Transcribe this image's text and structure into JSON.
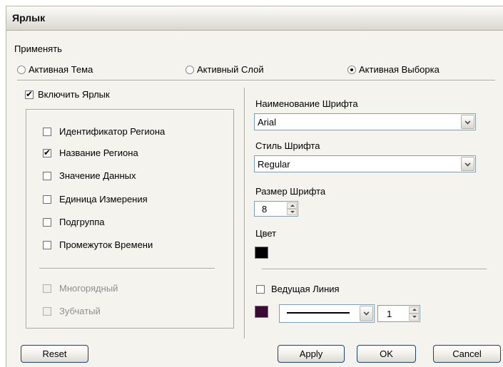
{
  "window": {
    "title": "Ярлык"
  },
  "apply_to": {
    "label": "Применять",
    "options": [
      {
        "label": "Активная Тема",
        "checked": false
      },
      {
        "label": "Активный Слой",
        "checked": false
      },
      {
        "label": "Активная Выборка",
        "checked": true
      }
    ]
  },
  "left": {
    "enable_label": {
      "label": "Включить Ярлык",
      "checked": true
    },
    "fields": [
      {
        "label": "Идентификатор Региона",
        "checked": false
      },
      {
        "label": "Название Региона",
        "checked": true
      },
      {
        "label": "Значение Данных",
        "checked": false
      },
      {
        "label": "Единица Измерения",
        "checked": false
      },
      {
        "label": "Подгруппа",
        "checked": false
      },
      {
        "label": "Промежуток Времени",
        "checked": false
      }
    ],
    "multiline": {
      "label": "Многорядный",
      "checked": false,
      "disabled": true
    },
    "jagged": {
      "label": "Зубчатый",
      "checked": false,
      "disabled": true
    }
  },
  "right": {
    "font_name_label": "Наименование Шрифта",
    "font_name_value": "Arial",
    "font_style_label": "Стиль Шрифта",
    "font_style_value": "Regular",
    "font_size_label": "Размер Шрифта",
    "font_size_value": "8",
    "color_label": "Цвет",
    "color_value": "#000000",
    "leader_line": {
      "label": "Ведущая Линия",
      "checked": false
    },
    "leader_color": "#3b0a35",
    "line_width_value": "1"
  },
  "buttons": {
    "reset": "Reset",
    "apply": "Apply",
    "ok": "OK",
    "cancel": "Cancel"
  }
}
